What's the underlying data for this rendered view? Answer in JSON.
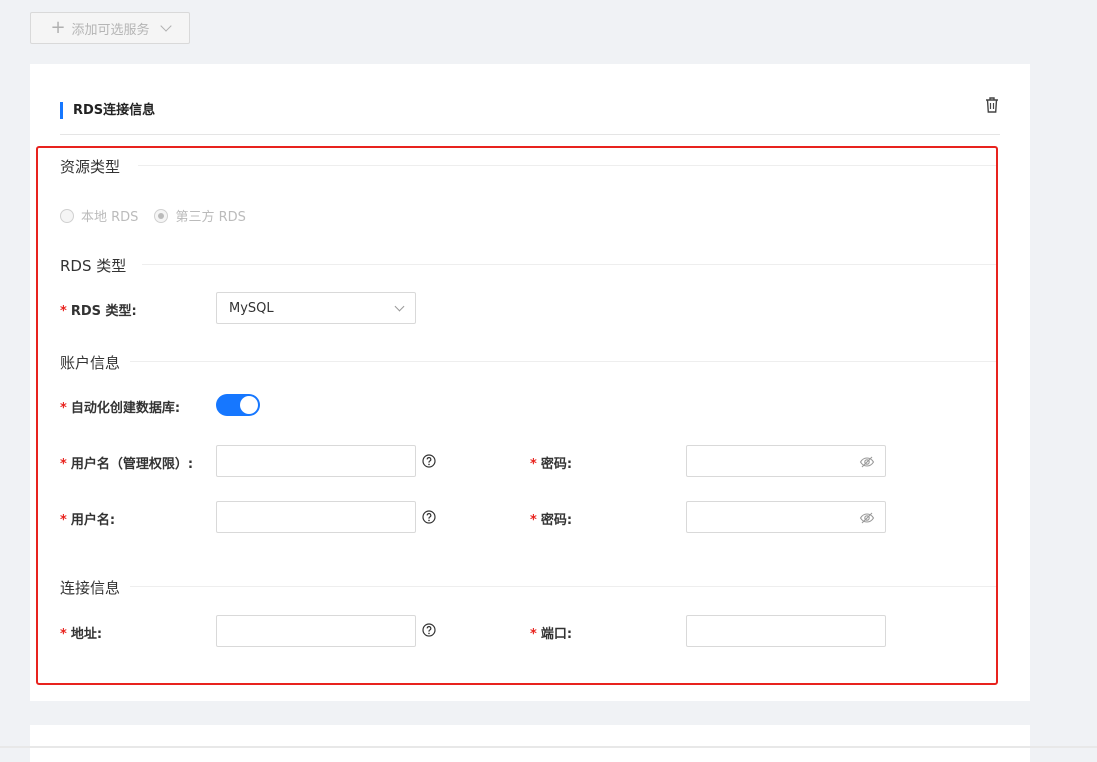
{
  "toolbar": {
    "add_service_label": "添加可选服务"
  },
  "section": {
    "title": "RDS连接信息"
  },
  "groups": {
    "resource_type": "资源类型",
    "rds_type": "RDS 类型",
    "account": "账户信息",
    "connection": "连接信息"
  },
  "resource_options": [
    {
      "label": "本地 RDS",
      "checked": false,
      "disabled": true
    },
    {
      "label": "第三方 RDS",
      "checked": true,
      "disabled": true
    }
  ],
  "fields": {
    "rds_type_label": "RDS 类型:",
    "rds_type_value": "MySQL",
    "auto_create_label": "自动化创建数据库:",
    "auto_create_on": true,
    "admin_user_label": "用户名（管理权限）:",
    "admin_password_label": "密码:",
    "user_label": "用户名:",
    "user_password_label": "密码:",
    "address_label": "地址:",
    "port_label": "端口:"
  },
  "required_mark": "*",
  "colors": {
    "accent": "#1677ff",
    "required": "#e8231e",
    "highlight": "#e8231e"
  },
  "icons": {
    "delete": "trash-icon",
    "help": "question-circle-icon",
    "password": "eye-invisible-icon"
  }
}
